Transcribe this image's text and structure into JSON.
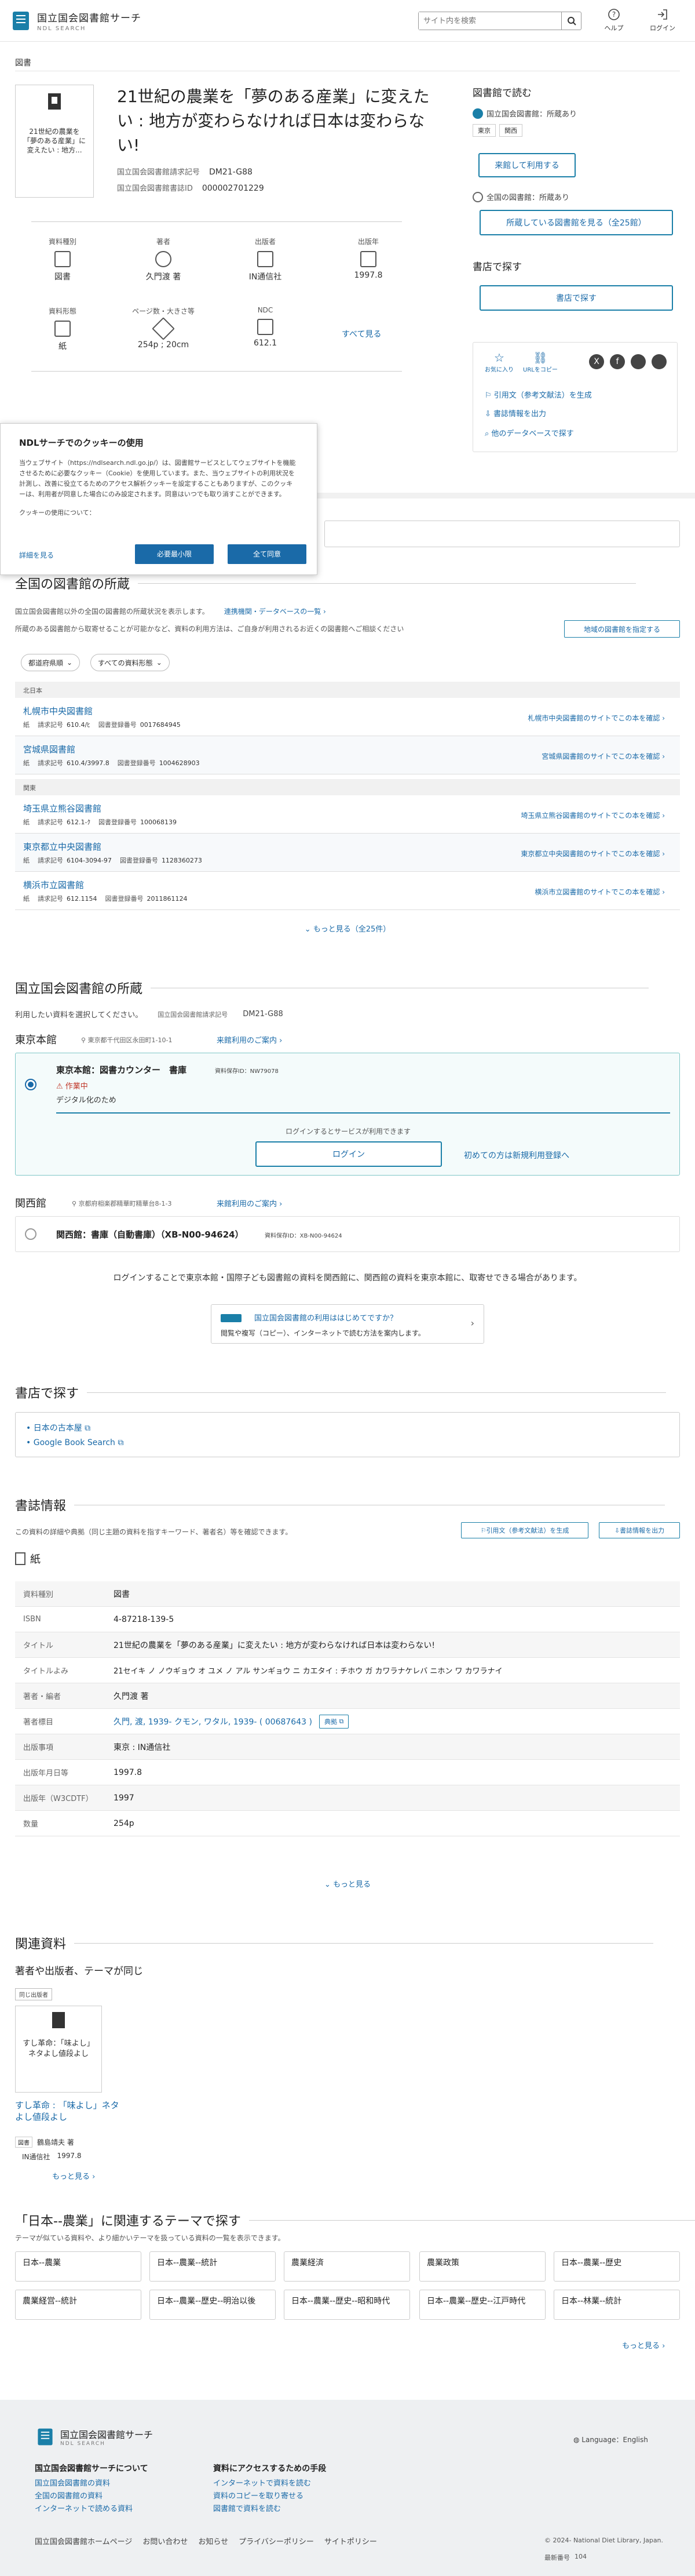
{
  "header": {
    "logo_main": "国立国会図書館サーチ",
    "logo_sub": "NDL SEARCH",
    "search_placeholder": "サイト内を検索",
    "help": "ヘルプ",
    "login": "ログイン"
  },
  "breadcrumb": "図書",
  "book": {
    "cover_text": "21世紀の農業を「夢のある産業」に変えたい : 地方...",
    "title": "21世紀の農業を「夢のある産業」に変えたい : 地方が変わらなければ日本は変わらない!",
    "call_label": "国立国会図書館請求記号",
    "call_value": "DM21-G88",
    "bib_label": "国立国会図書館書誌ID",
    "bib_value": "000002701229"
  },
  "attributes": [
    {
      "label": "資料種別",
      "value": "図書"
    },
    {
      "label": "著者",
      "value": "久門渡 著"
    },
    {
      "label": "出版者",
      "value": "IN通信社"
    },
    {
      "label": "出版年",
      "value": "1997.8"
    },
    {
      "label": "資料形態",
      "value": "紙"
    },
    {
      "label": "ページ数・大きさ等",
      "value": "254p ; 20cm"
    },
    {
      "label": "NDC",
      "value": "612.1"
    }
  ],
  "see_all": "すべて見る",
  "right": {
    "read_heading": "図書館で読む",
    "ndl_has": "国立国会図書館：所蔵あり",
    "loc1": "東京",
    "loc2": "関西",
    "apply_btn": "来館して利用する",
    "all_has": "全国の図書館：所蔵あり",
    "see_libs_btn": "所蔵している図書館を見る（全25館）",
    "store_heading": "書店で探す",
    "store_btn": "書店で探す",
    "share_label": "お気に入り",
    "url_copy": "URLをコピー",
    "cite": "引用文（参考文献法）を生成",
    "export": "書誌情報を出力",
    "other_db": "他のデータベースで探す"
  },
  "cookie": {
    "title": "NDLサーチでのクッキーの使用",
    "body": "当ウェブサイト（https://ndlsearch.ndl.go.jp/）は、図書館サービスとしてウェブサイトを機能させるために必要なクッキー（Cookie）を使用しています。また、当ウェブサイトの利用状況を計測し、改善に役立てるためのアクセス解析クッキーを設定することもありますが、このクッキーは、利用者が同意した場合にのみ設定されます。同意はいつでも取り消すことができます。",
    "usage": "クッキーの使用について：",
    "details": "詳細を見る",
    "necessary": "必要最小限",
    "accept": "全て同意"
  },
  "national": {
    "heading": "全国の図書館の所蔵",
    "desc": "国立国会図書館以外の全国の図書館の所蔵状況を表示します。",
    "link": "連携機関・データベースの一覧",
    "note": "所蔵のある図書館から取寄せることが可能かなど、資料の利用方法は、ご自身が利用されるお近くの図書館へご相談ください",
    "region_btn": "地域の図書館を指定する",
    "filter1": "都道府県順",
    "filter2": "すべての資料形態",
    "regions": [
      "北日本",
      "関東"
    ],
    "libs": [
      {
        "name": "札幌市中央図書館",
        "form": "紙",
        "call": "610.4/ﾋ",
        "reg": "0017684945",
        "act": "札幌市中央図書館のサイトでこの本を確認"
      },
      {
        "name": "宮城県図書館",
        "form": "紙",
        "call": "610.4/3997.8",
        "reg": "1004628903",
        "act": "宮城県図書館のサイトでこの本を確認"
      },
      {
        "name": "埼玉県立熊谷図書館",
        "form": "紙",
        "call": "612.1-ｸ",
        "reg": "100068139",
        "act": "埼玉県立熊谷図書館のサイトでこの本を確認"
      },
      {
        "name": "東京都立中央図書館",
        "form": "紙",
        "call": "6104-3094-97",
        "reg": "1128360273",
        "act": "東京都立中央図書館のサイトでこの本を確認"
      },
      {
        "name": "横浜市立図書館",
        "form": "紙",
        "call": "612.1154",
        "reg": "2011861124",
        "act": "横浜市立図書館のサイトでこの本を確認"
      }
    ],
    "call_label": "請求記号",
    "reg_label": "図書登録番号",
    "more": "もっと見る（全25件）"
  },
  "ndl_holdings": {
    "heading": "国立国会図書館の所蔵",
    "select_text": "利用したい資料を選択してください。",
    "call_label": "国立国会図書館請求記号",
    "call_value": "DM21-G88",
    "tokyo": "東京本館",
    "tokyo_addr": "東京都千代田区永田町1-10-1",
    "tokyo_guide": "来館利用のご案内",
    "counter": "東京本館：図書カウンター　書庫",
    "counter_id": "資料保存ID：NW79078",
    "status": "作業中",
    "status_note": "デジタル化のため",
    "login_note": "ログインするとサービスが利用できます",
    "login_btn": "ログイン",
    "register": "初めての方は新規利用登録へ",
    "kansai": "関西館",
    "kansai_addr": "京都府相楽郡精華町精華台8-1-3",
    "kansai_guide": "来館利用のご案内",
    "kansai_item": "関西館：書庫（自動書庫）（XB-N00-94624）",
    "kansai_id": "資料保存ID：XB-N00-94624",
    "transfer_note": "ログインすることで東京本館・国際子ども図書館の資料を関西館に、関西館の資料を東京本館に、取寄せできる場合があります。",
    "first_title": "国立国会図書館の利用ははじめてですか？",
    "first_sub": "閲覧や複写（コピー）、インターネットで読む方法を案内します。"
  },
  "bookstore": {
    "heading": "書店で探す",
    "l1": "日本の古本屋",
    "l2": "Google Book Search"
  },
  "bib": {
    "heading": "書誌情報",
    "desc": "この資料の詳細や典拠（同じ主題の資料を指すキーワード、著者名）等を確認できます。",
    "cite": "引用文（参考文献法）を生成",
    "export": "書誌情報を出力",
    "form": "紙",
    "rows": [
      {
        "k": "資料種別",
        "v": "図書"
      },
      {
        "k": "ISBN",
        "v": "4-87218-139-5"
      },
      {
        "k": "タイトル",
        "v": "21世紀の農業を「夢のある産業」に変えたい : 地方が変わらなければ日本は変わらない!"
      },
      {
        "k": "タイトルよみ",
        "v": "21セイキ ノ ノウギョウ オ ユメ ノ アル サンギョウ ニ カエタイ : チホウ ガ カワラナケレバ ニホン ワ カワラナイ"
      },
      {
        "k": "著者・編者",
        "v": "久門渡 著"
      },
      {
        "k": "著者標目",
        "v": "久門, 渡, 1939- クモン, ワタル, 1939- ( 00687643 )"
      },
      {
        "k": "出版事項",
        "v": "東京 : IN通信社"
      },
      {
        "k": "出版年月日等",
        "v": "1997.8"
      },
      {
        "k": "出版年（W3CDTF）",
        "v": "1997"
      },
      {
        "k": "数量",
        "v": "254p"
      }
    ],
    "authority": "典拠",
    "more": "もっと見る"
  },
  "related": {
    "heading": "関連資料",
    "sub": "著者や出版者、テーマが同じ",
    "badge": "同じ出版者",
    "cover_text": "すし革命：「味よし」ネタよし値段よし",
    "title": "すし革命 : 「味よし」ネタよし値段よし",
    "type": "図書",
    "author": "鶴島靖夫 著",
    "pub": "IN通信社",
    "year": "1997.8",
    "more": "もっと見る"
  },
  "themes": {
    "heading": "「日本--農業」に関連するテーマで探す",
    "sub": "テーマが似ている資料や、より細かいテーマを扱っている資料の一覧を表示できます。",
    "items": [
      "日本--農業",
      "日本--農業--統計",
      "農業経済",
      "農業政策",
      "日本--農業--歴史",
      "農業経営--統計",
      "日本--農業--歴史--明治以後",
      "日本--農業--歴史--昭和時代",
      "日本--農業--歴史--江戸時代",
      "日本--林業--統計"
    ],
    "more": "もっと見る"
  },
  "footer": {
    "lang": "Language：English",
    "about": "国立国会図書館サーチについて",
    "a1": "国立国会図書館の資料",
    "a2": "全国の図書館の資料",
    "a3": "インターネットで読める資料",
    "access": "資料にアクセスするための手段",
    "b1": "インターネットで資料を読む",
    "b2": "資料のコピーを取り寄せる",
    "b3": "図書館で資料を読む",
    "bottom": [
      "国立国会図書館ホームページ",
      "お問い合わせ",
      "お知らせ",
      "プライバシーポリシー",
      "サイトポリシー"
    ],
    "copyright": "© 2024- National Diet Library, Japan.",
    "vol_label": "最新番号",
    "vol": "104"
  }
}
